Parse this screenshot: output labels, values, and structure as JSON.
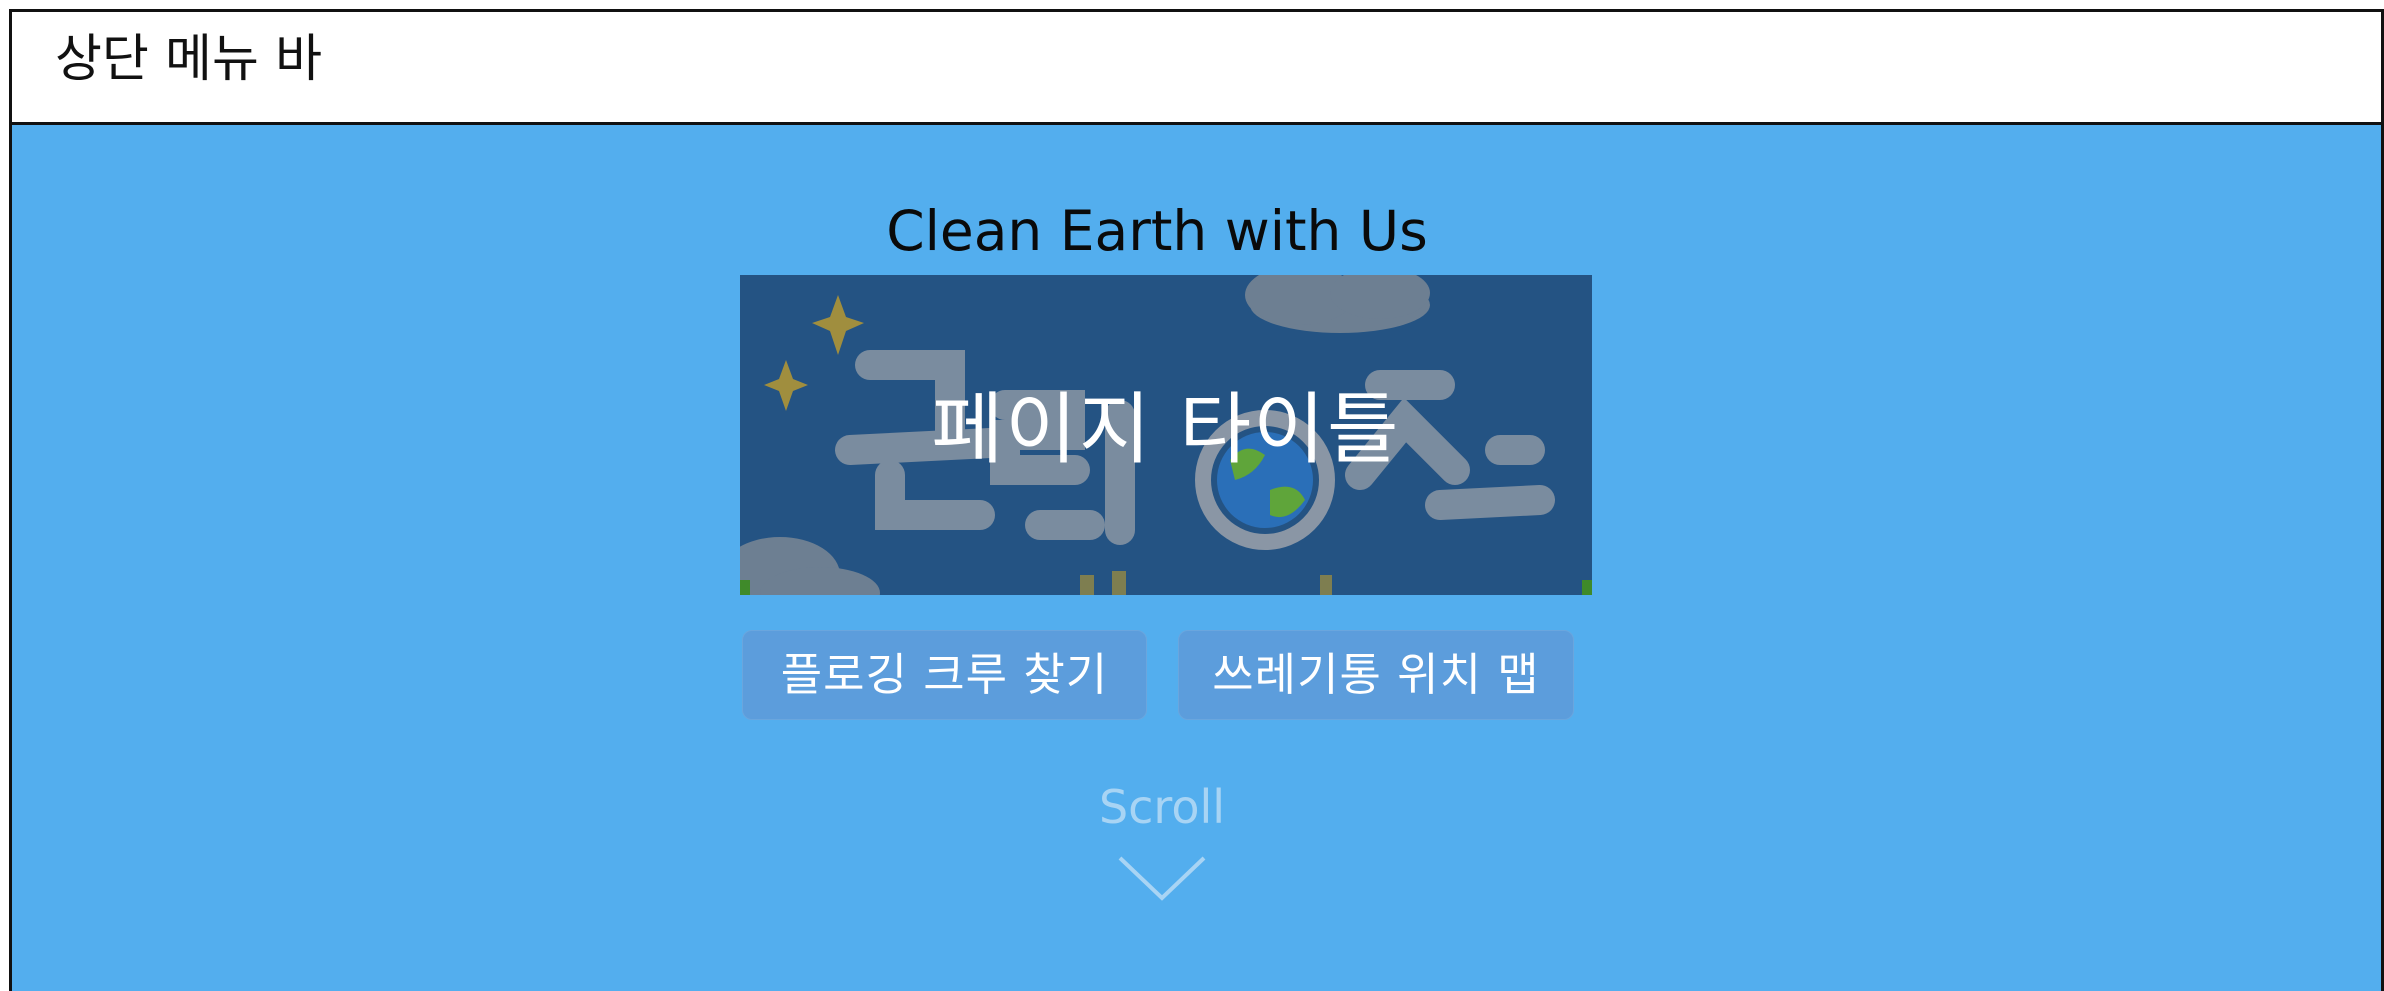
{
  "top_bar": {
    "label": "상단 메뉴 바"
  },
  "hero": {
    "tagline": "Clean Earth with Us",
    "banner": {
      "title": "페이지 타이틀",
      "background_art_text": "클린어스"
    },
    "buttons": {
      "crew_finder": "플로깅 크루 찾기",
      "trash_map": "쓰레기통 위치 맵"
    },
    "scroll_hint": {
      "label": "Scroll",
      "icon": "chevron-down-icon"
    }
  },
  "colors": {
    "hero_background": "#53aeee",
    "banner_background": "#245383",
    "button_background": "#5c9ddc",
    "scroll_hint": "#a8d4f4"
  }
}
